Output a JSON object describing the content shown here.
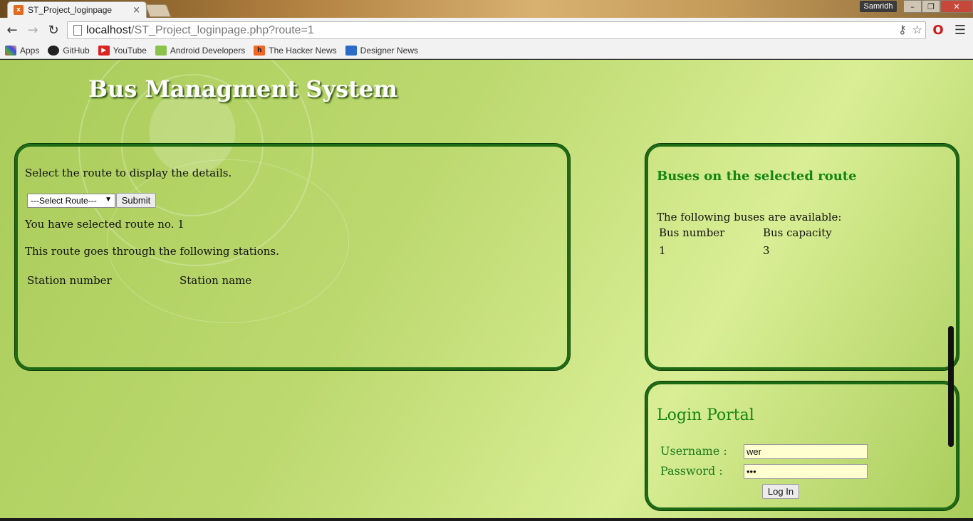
{
  "browser": {
    "tab_title": "ST_Project_loginpage",
    "user": "Samridh",
    "url_host": "localhost",
    "url_path": "/ST_Project_loginpage.php?route=1",
    "bookmarks": [
      {
        "label": "Apps",
        "icon": "apps-grid-icon"
      },
      {
        "label": "GitHub",
        "icon": "github-icon"
      },
      {
        "label": "YouTube",
        "icon": "youtube-icon"
      },
      {
        "label": "Android Developers",
        "icon": "android-icon"
      },
      {
        "label": "The Hacker News",
        "icon": "hacker-news-icon"
      },
      {
        "label": "Designer News",
        "icon": "designer-news-icon"
      }
    ]
  },
  "site": {
    "title": "Bus Managment System"
  },
  "route_panel": {
    "instruction": "Select the route to display the details.",
    "select_value": "---Select Route---",
    "submit_label": "Submit",
    "selected_text": "You have selected route no. 1",
    "stations_text": "This route goes through the following stations.",
    "col_station_number": "Station number",
    "col_station_name": "Station name"
  },
  "buses_panel": {
    "heading": "Buses on the selected route",
    "available_text": "The following buses are available:",
    "col_bus_number": "Bus number",
    "col_bus_capacity": "Bus capacity",
    "rows": [
      {
        "number": "1",
        "capacity": "3"
      }
    ]
  },
  "login_panel": {
    "heading": "Login Portal",
    "username_label": "Username :",
    "password_label": "Password :",
    "username_value": "wer",
    "password_value": "•••",
    "login_label": "Log In"
  },
  "colors": {
    "panel_border": "#1e6a14",
    "heading_green": "#128512"
  }
}
